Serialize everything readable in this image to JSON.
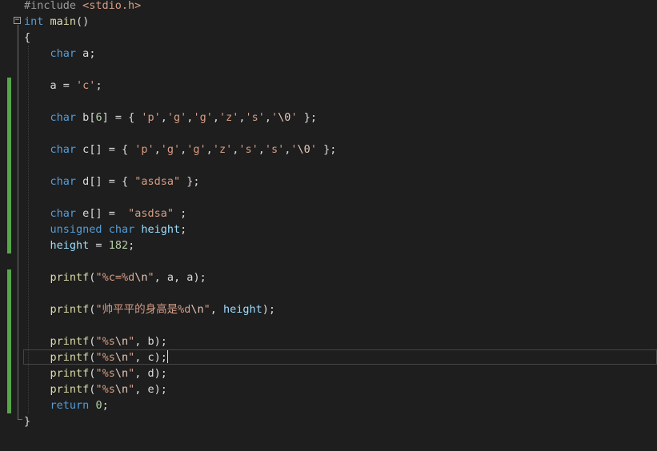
{
  "editor": {
    "lines": [
      [
        {
          "t": "pp",
          "v": "#include "
        },
        {
          "t": "inc",
          "v": "<stdio.h>"
        }
      ],
      [
        {
          "t": "kw",
          "v": "int"
        },
        {
          "t": "pl",
          "v": " "
        },
        {
          "t": "fn",
          "v": "main"
        },
        {
          "t": "pl",
          "v": "()"
        }
      ],
      [
        {
          "t": "pl",
          "v": "{"
        }
      ],
      [
        {
          "t": "pl",
          "v": "    "
        },
        {
          "t": "kw",
          "v": "char"
        },
        {
          "t": "pl",
          "v": " "
        },
        {
          "t": "id",
          "v": "a"
        },
        {
          "t": "pl",
          "v": ";"
        }
      ],
      [],
      [
        {
          "t": "pl",
          "v": "    "
        },
        {
          "t": "id",
          "v": "a"
        },
        {
          "t": "pl",
          "v": " = "
        },
        {
          "t": "str",
          "v": "'c'"
        },
        {
          "t": "pl",
          "v": ";"
        }
      ],
      [],
      [
        {
          "t": "pl",
          "v": "    "
        },
        {
          "t": "kw",
          "v": "char"
        },
        {
          "t": "pl",
          "v": " "
        },
        {
          "t": "id",
          "v": "b"
        },
        {
          "t": "pl",
          "v": "["
        },
        {
          "t": "num",
          "v": "6"
        },
        {
          "t": "pl",
          "v": "] = { "
        },
        {
          "t": "str",
          "v": "'p'"
        },
        {
          "t": "pl",
          "v": ","
        },
        {
          "t": "str",
          "v": "'g'"
        },
        {
          "t": "pl",
          "v": ","
        },
        {
          "t": "str",
          "v": "'g'"
        },
        {
          "t": "pl",
          "v": ","
        },
        {
          "t": "str",
          "v": "'z'"
        },
        {
          "t": "pl",
          "v": ","
        },
        {
          "t": "str",
          "v": "'s'"
        },
        {
          "t": "pl",
          "v": ","
        },
        {
          "t": "str",
          "v": "'"
        },
        {
          "t": "esc",
          "v": "\\0"
        },
        {
          "t": "str",
          "v": "'"
        },
        {
          "t": "pl",
          "v": " };"
        }
      ],
      [],
      [
        {
          "t": "pl",
          "v": "    "
        },
        {
          "t": "kw",
          "v": "char"
        },
        {
          "t": "pl",
          "v": " "
        },
        {
          "t": "id",
          "v": "c"
        },
        {
          "t": "pl",
          "v": "[] = { "
        },
        {
          "t": "str",
          "v": "'p'"
        },
        {
          "t": "pl",
          "v": ","
        },
        {
          "t": "str",
          "v": "'g'"
        },
        {
          "t": "pl",
          "v": ","
        },
        {
          "t": "str",
          "v": "'g'"
        },
        {
          "t": "pl",
          "v": ","
        },
        {
          "t": "str",
          "v": "'z'"
        },
        {
          "t": "pl",
          "v": ","
        },
        {
          "t": "str",
          "v": "'s'"
        },
        {
          "t": "pl",
          "v": ","
        },
        {
          "t": "str",
          "v": "'s'"
        },
        {
          "t": "pl",
          "v": ","
        },
        {
          "t": "str",
          "v": "'"
        },
        {
          "t": "esc",
          "v": "\\0"
        },
        {
          "t": "str",
          "v": "'"
        },
        {
          "t": "pl",
          "v": " };"
        }
      ],
      [],
      [
        {
          "t": "pl",
          "v": "    "
        },
        {
          "t": "kw",
          "v": "char"
        },
        {
          "t": "pl",
          "v": " "
        },
        {
          "t": "id",
          "v": "d"
        },
        {
          "t": "pl",
          "v": "[] = { "
        },
        {
          "t": "str",
          "v": "\"asdsa\""
        },
        {
          "t": "pl",
          "v": " };"
        }
      ],
      [],
      [
        {
          "t": "pl",
          "v": "    "
        },
        {
          "t": "kw",
          "v": "char"
        },
        {
          "t": "pl",
          "v": " "
        },
        {
          "t": "id",
          "v": "e"
        },
        {
          "t": "pl",
          "v": "[] =  "
        },
        {
          "t": "str",
          "v": "\"asdsa\""
        },
        {
          "t": "pl",
          "v": " ;"
        }
      ],
      [
        {
          "t": "pl",
          "v": "    "
        },
        {
          "t": "kw",
          "v": "unsigned"
        },
        {
          "t": "pl",
          "v": " "
        },
        {
          "t": "kw",
          "v": "char"
        },
        {
          "t": "pl",
          "v": " "
        },
        {
          "t": "id2",
          "v": "height"
        },
        {
          "t": "pl",
          "v": ";"
        }
      ],
      [
        {
          "t": "pl",
          "v": "    "
        },
        {
          "t": "id2",
          "v": "height"
        },
        {
          "t": "pl",
          "v": " = "
        },
        {
          "t": "num",
          "v": "182"
        },
        {
          "t": "pl",
          "v": ";"
        }
      ],
      [],
      [
        {
          "t": "pl",
          "v": "    "
        },
        {
          "t": "fn",
          "v": "printf"
        },
        {
          "t": "pl",
          "v": "("
        },
        {
          "t": "str",
          "v": "\"%c=%d"
        },
        {
          "t": "esc",
          "v": "\\n"
        },
        {
          "t": "str",
          "v": "\""
        },
        {
          "t": "pl",
          "v": ", "
        },
        {
          "t": "id",
          "v": "a"
        },
        {
          "t": "pl",
          "v": ", "
        },
        {
          "t": "id",
          "v": "a"
        },
        {
          "t": "pl",
          "v": ");"
        }
      ],
      [],
      [
        {
          "t": "pl",
          "v": "    "
        },
        {
          "t": "fn",
          "v": "printf"
        },
        {
          "t": "pl",
          "v": "("
        },
        {
          "t": "str",
          "v": "\"帅平平的身高是%d"
        },
        {
          "t": "esc",
          "v": "\\n"
        },
        {
          "t": "str",
          "v": "\""
        },
        {
          "t": "pl",
          "v": ", "
        },
        {
          "t": "id2",
          "v": "height"
        },
        {
          "t": "pl",
          "v": ");"
        }
      ],
      [],
      [
        {
          "t": "pl",
          "v": "    "
        },
        {
          "t": "fn",
          "v": "printf"
        },
        {
          "t": "pl",
          "v": "("
        },
        {
          "t": "str",
          "v": "\"%s"
        },
        {
          "t": "esc",
          "v": "\\n"
        },
        {
          "t": "str",
          "v": "\""
        },
        {
          "t": "pl",
          "v": ", "
        },
        {
          "t": "id",
          "v": "b"
        },
        {
          "t": "pl",
          "v": ");"
        }
      ],
      [
        {
          "t": "pl",
          "v": "    "
        },
        {
          "t": "fn",
          "v": "printf"
        },
        {
          "t": "pl",
          "v": "("
        },
        {
          "t": "str",
          "v": "\"%s"
        },
        {
          "t": "esc",
          "v": "\\n"
        },
        {
          "t": "str",
          "v": "\""
        },
        {
          "t": "pl",
          "v": ", "
        },
        {
          "t": "id",
          "v": "c"
        },
        {
          "t": "pl",
          "v": ");"
        },
        {
          "t": "caret",
          "v": ""
        }
      ],
      [
        {
          "t": "pl",
          "v": "    "
        },
        {
          "t": "fn",
          "v": "printf"
        },
        {
          "t": "pl",
          "v": "("
        },
        {
          "t": "str",
          "v": "\"%s"
        },
        {
          "t": "esc",
          "v": "\\n"
        },
        {
          "t": "str",
          "v": "\""
        },
        {
          "t": "pl",
          "v": ", "
        },
        {
          "t": "id",
          "v": "d"
        },
        {
          "t": "pl",
          "v": ");"
        }
      ],
      [
        {
          "t": "pl",
          "v": "    "
        },
        {
          "t": "fn",
          "v": "printf"
        },
        {
          "t": "pl",
          "v": "("
        },
        {
          "t": "str",
          "v": "\"%s"
        },
        {
          "t": "esc",
          "v": "\\n"
        },
        {
          "t": "str",
          "v": "\""
        },
        {
          "t": "pl",
          "v": ", "
        },
        {
          "t": "id",
          "v": "e"
        },
        {
          "t": "pl",
          "v": ");"
        }
      ],
      [
        {
          "t": "pl",
          "v": "    "
        },
        {
          "t": "kw",
          "v": "return"
        },
        {
          "t": "pl",
          "v": " "
        },
        {
          "t": "num",
          "v": "0"
        },
        {
          "t": "pl",
          "v": ";"
        }
      ],
      [
        {
          "t": "pl",
          "v": "}"
        }
      ]
    ],
    "current_line": 22,
    "fold_toggle_symbol": "−",
    "colors": {
      "background": "#1e1e1e",
      "keyword": "#569cd6",
      "function": "#dcdcaa",
      "string": "#d69d85",
      "number": "#b5cea8",
      "change_bar": "#57a64a"
    }
  }
}
